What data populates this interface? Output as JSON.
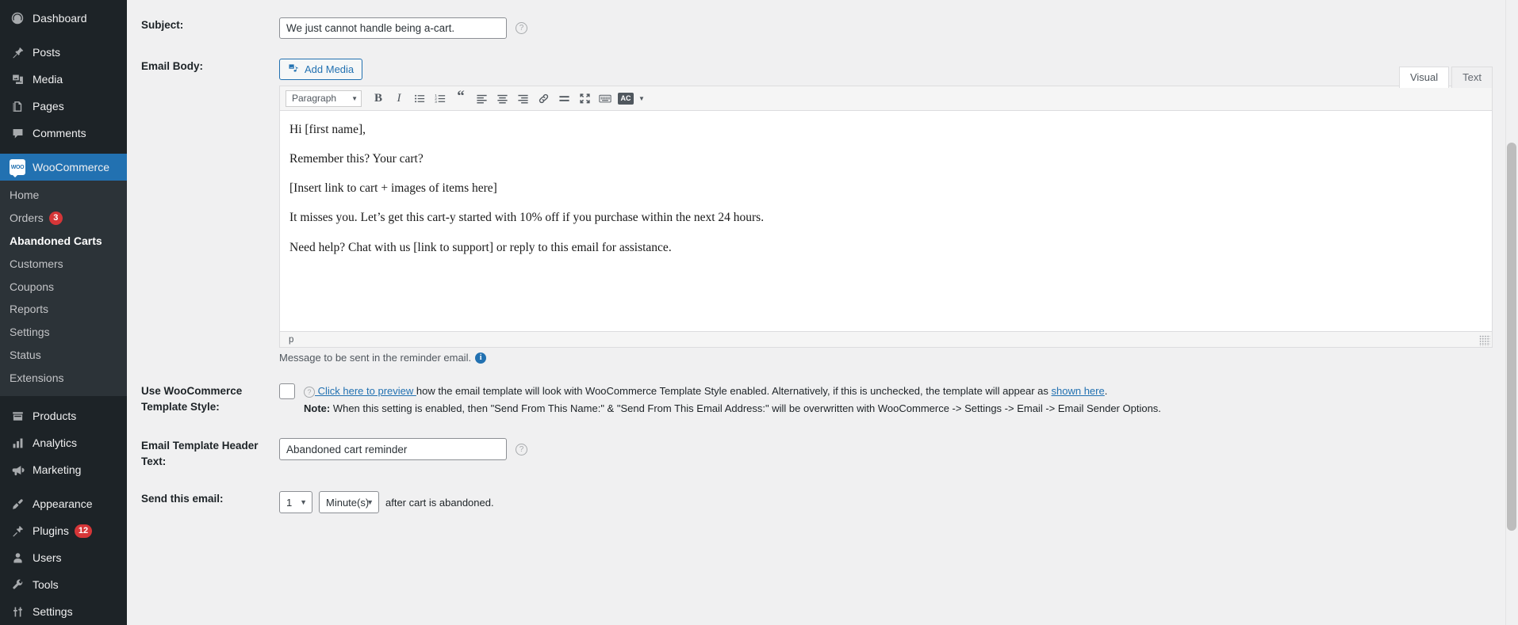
{
  "sidebar": {
    "top_items": [
      {
        "label": "Dashboard",
        "icon": "dashboard-icon"
      },
      {
        "label": "Posts",
        "icon": "pin-icon"
      },
      {
        "label": "Media",
        "icon": "media-icon"
      },
      {
        "label": "Pages",
        "icon": "pages-icon"
      },
      {
        "label": "Comments",
        "icon": "comments-icon"
      }
    ],
    "current_item": {
      "label": "WooCommerce",
      "icon": "woocommerce-logo-icon"
    },
    "submenu": [
      {
        "label": "Home",
        "badge": ""
      },
      {
        "label": "Orders",
        "badge": "3"
      },
      {
        "label": "Abandoned Carts",
        "badge": "",
        "active": true
      },
      {
        "label": "Customers",
        "badge": ""
      },
      {
        "label": "Coupons",
        "badge": ""
      },
      {
        "label": "Reports",
        "badge": ""
      },
      {
        "label": "Settings",
        "badge": ""
      },
      {
        "label": "Status",
        "badge": ""
      },
      {
        "label": "Extensions",
        "badge": ""
      }
    ],
    "bottom_items": [
      {
        "label": "Products",
        "icon": "products-icon",
        "badge": ""
      },
      {
        "label": "Analytics",
        "icon": "analytics-icon",
        "badge": ""
      },
      {
        "label": "Marketing",
        "icon": "marketing-icon",
        "badge": ""
      },
      {
        "label": "Appearance",
        "icon": "appearance-icon",
        "badge": ""
      },
      {
        "label": "Plugins",
        "icon": "plugins-icon",
        "badge": "12"
      },
      {
        "label": "Users",
        "icon": "users-icon",
        "badge": ""
      },
      {
        "label": "Tools",
        "icon": "tools-icon",
        "badge": ""
      },
      {
        "label": "Settings",
        "icon": "settings-icon",
        "badge": ""
      }
    ],
    "colors": {
      "background": "#1d2327",
      "submenu_background": "#2c3338",
      "current": "#2271b1",
      "badge": "#d63638"
    }
  },
  "form": {
    "subject": {
      "label": "Subject:",
      "value": "We just cannot handle being a-cart.",
      "help_icon": "help-circle-icon"
    },
    "email_body": {
      "label": "Email Body:",
      "add_media_label": "Add Media",
      "add_media_icon": "media-add-icon",
      "tabs": [
        {
          "label": "Visual",
          "active": true
        },
        {
          "label": "Text",
          "active": false
        }
      ],
      "toolbar": {
        "format_select": "Paragraph",
        "buttons": [
          {
            "name": "bold-icon",
            "glyph": "B"
          },
          {
            "name": "italic-icon",
            "glyph": "I"
          },
          {
            "name": "bulleted-list-icon",
            "glyph": ""
          },
          {
            "name": "numbered-list-icon",
            "glyph": ""
          },
          {
            "name": "blockquote-icon",
            "glyph": "“"
          },
          {
            "name": "align-left-icon",
            "glyph": ""
          },
          {
            "name": "align-center-icon",
            "glyph": ""
          },
          {
            "name": "align-right-icon",
            "glyph": ""
          },
          {
            "name": "insert-link-icon",
            "glyph": ""
          },
          {
            "name": "read-more-icon",
            "glyph": ""
          },
          {
            "name": "fullscreen-icon",
            "glyph": ""
          },
          {
            "name": "keyboard-shortcuts-icon",
            "glyph": ""
          },
          {
            "name": "spellcheck-abc-icon",
            "glyph": "AC"
          }
        ]
      },
      "paragraphs": [
        "Hi [first name],",
        "Remember this? Your cart?",
        "[Insert link to cart + images of items here]",
        "It misses you. Let’s get this cart-y started with 10% off if you purchase within the next 24 hours.",
        "Need help? Chat with us [link to support] or reply to this email for assistance."
      ],
      "statusbar_path": "p",
      "hint": "Message to be sent in the reminder email.",
      "hint_icon": "info-icon"
    },
    "template_style": {
      "label": "Use WooCommerce Template Style:",
      "checked": false,
      "preview_icon": "help-circle-icon",
      "preview_link": " Click here to preview ",
      "description_before": "how the email template will look with WooCommerce Template Style enabled. Alternatively, if this is unchecked, the template will appear as ",
      "shown_here_link": "shown here",
      "description_after": ".",
      "note_label": "Note:",
      "note_text": " When this setting is enabled, then \"Send From This Name:\" & \"Send From This Email Address:\" will be overwritten with WooCommerce -> Settings -> Email -> Email Sender Options."
    },
    "header_text": {
      "label": "Email Template Header Text:",
      "value": "Abandoned cart reminder",
      "help_icon": "help-circle-icon"
    },
    "send_email": {
      "label": "Send this email:",
      "amount_value": "1",
      "unit_value": "Minute(s)",
      "after_text": "after cart is abandoned."
    }
  }
}
